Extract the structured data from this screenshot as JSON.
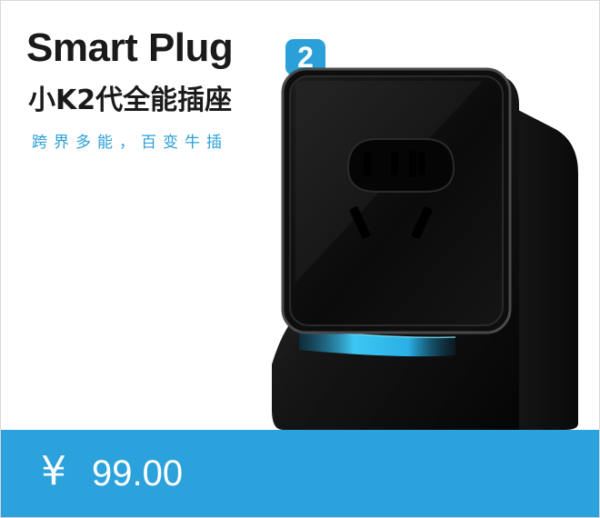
{
  "product": {
    "name": "Smart Plug",
    "generation_badge": "2",
    "chinese_name": "小K2代全能插座",
    "slogan": "跨界多能，百变牛插"
  },
  "price": {
    "currency_symbol": "¥",
    "amount": "99.00"
  },
  "colors": {
    "accent": "#2ba2dc",
    "title": "#1a1a1a",
    "plug_body": "#151515",
    "glow": "#3fd0ff"
  }
}
